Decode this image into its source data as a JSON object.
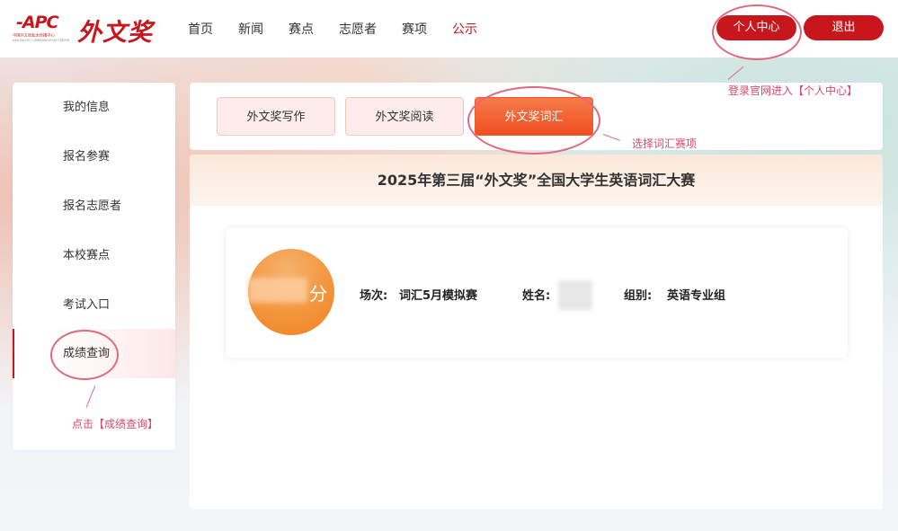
{
  "header": {
    "apc_logo_text": "-APC",
    "apc_sub_cn": "中国外文局亚太传播中心",
    "apc_sub_en": "ASIA-PACIFIC COMMUNICATION CENTER",
    "brand_logo_text": "外文奖",
    "nav": [
      "首页",
      "新闻",
      "赛点",
      "志愿者",
      "赛项",
      "公示"
    ],
    "nav_active": "公示",
    "personal_center_label": "个人中心",
    "logout_label": "退出"
  },
  "sidebar": {
    "items": [
      "我的信息",
      "报名参赛",
      "报名志愿者",
      "本校赛点",
      "考试入口",
      "成绩查询"
    ],
    "active": "成绩查询"
  },
  "tabs": [
    "外文奖写作",
    "外文奖阅读",
    "外文奖词汇"
  ],
  "active_tab": "外文奖词汇",
  "contest_title": "2025年第三届“外文奖”全国大学生英语词汇大赛",
  "result": {
    "score_unit": "分",
    "session_label": "场次:",
    "session_value": "词汇5月模拟赛",
    "name_label": "姓名:",
    "group_label": "组别:",
    "group_value": "英语专业组"
  },
  "annotations": {
    "login_note": "登录官网进入【个人中心】",
    "tab_note": "选择词汇赛项",
    "query_note": "点击【成绩查询】"
  },
  "colors": {
    "brand_red": "#c8161d",
    "tab_orange": "#ef4f22",
    "annotation": "#d9486a"
  }
}
